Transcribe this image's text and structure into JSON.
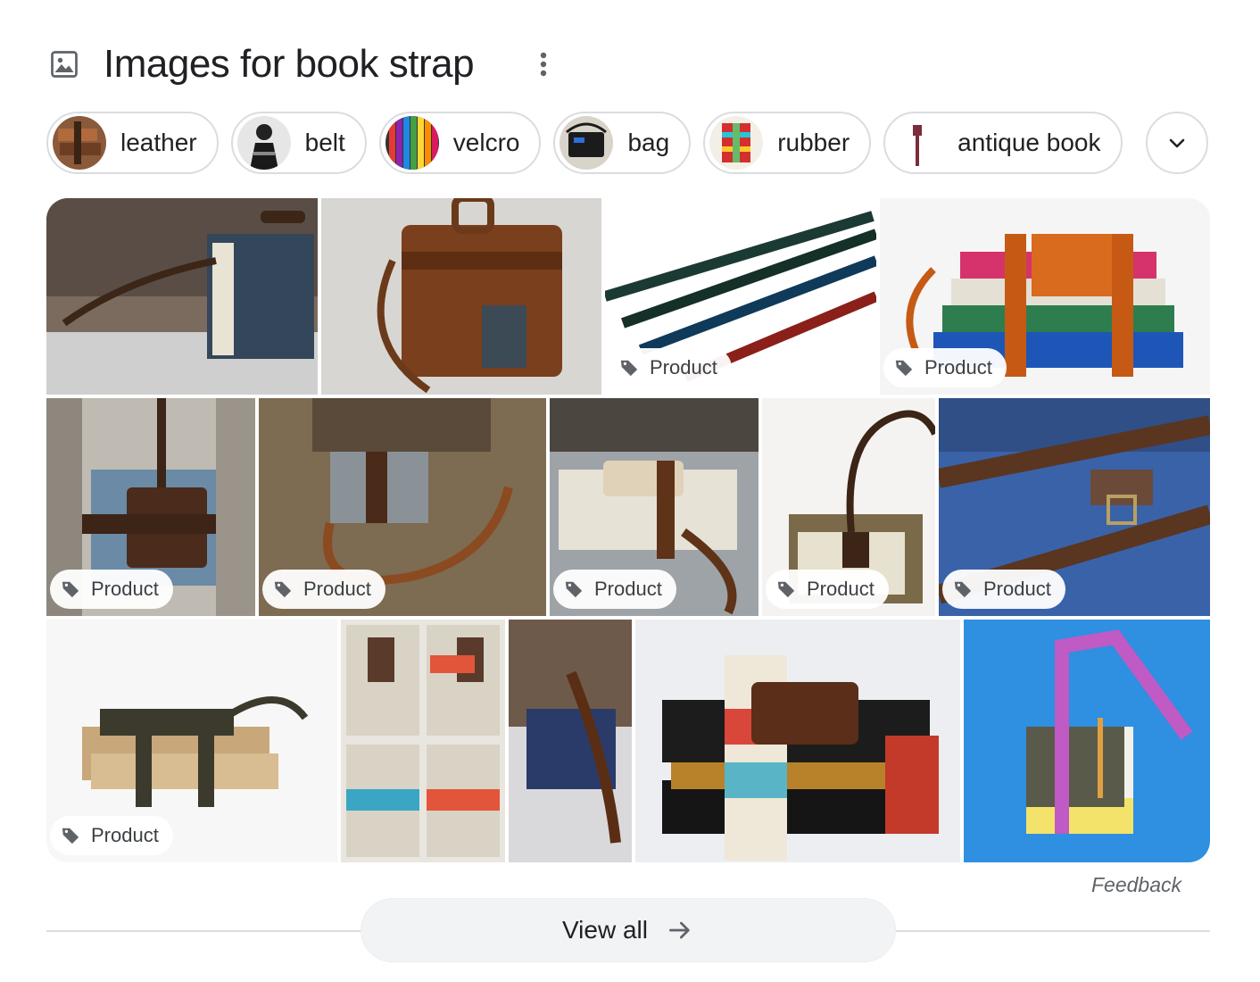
{
  "header": {
    "title": "Images for book strap",
    "icon": "image-icon",
    "menu_icon": "more-vert-icon"
  },
  "chips": [
    {
      "label": "leather"
    },
    {
      "label": "belt"
    },
    {
      "label": "velcro"
    },
    {
      "label": "bag"
    },
    {
      "label": "rubber"
    },
    {
      "label": "antique book"
    }
  ],
  "expand_icon": "chevron-down-icon",
  "badge_label": "Product",
  "badge_icon": "tag-icon",
  "feedback": "Feedback",
  "view_all": {
    "label": "View all",
    "icon": "arrow-right-icon"
  },
  "colors": {
    "text": "#202124",
    "secondary": "#5f6368",
    "border": "#dadce0",
    "button_bg": "#f1f3f4"
  }
}
